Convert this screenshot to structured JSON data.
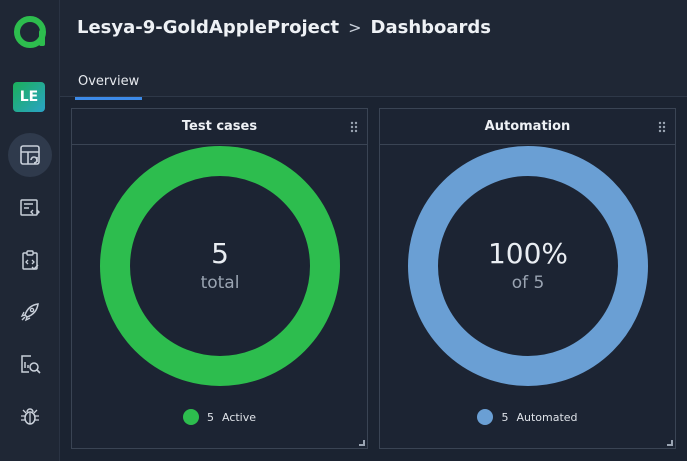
{
  "header": {
    "project": "Lesya-9-GoldAppleProject",
    "separator": ">",
    "page": "Dashboards"
  },
  "sidebar": {
    "avatar_initials": "LE",
    "items": [
      {
        "name": "dashboards-icon",
        "active": true
      },
      {
        "name": "test-cases-icon",
        "active": false
      },
      {
        "name": "test-plans-icon",
        "active": false
      },
      {
        "name": "launches-icon",
        "active": false
      },
      {
        "name": "analytics-icon",
        "active": false
      },
      {
        "name": "defects-icon",
        "active": false
      }
    ]
  },
  "tabs": [
    {
      "label": "Overview",
      "active": true
    }
  ],
  "widgets": {
    "test_cases": {
      "title": "Test cases",
      "value": "5",
      "sub": "total",
      "legend_count": "5",
      "legend_label": "Active",
      "color": "#2dbd4e",
      "fraction": 1.0
    },
    "automation": {
      "title": "Automation",
      "value": "100%",
      "sub": "of 5",
      "legend_count": "5",
      "legend_label": "Automated",
      "color": "#6a9fd4",
      "fraction": 1.0
    }
  },
  "colors": {
    "accent": "#3c8ae8",
    "background": "#1b2331",
    "panel": "#1f2735"
  }
}
